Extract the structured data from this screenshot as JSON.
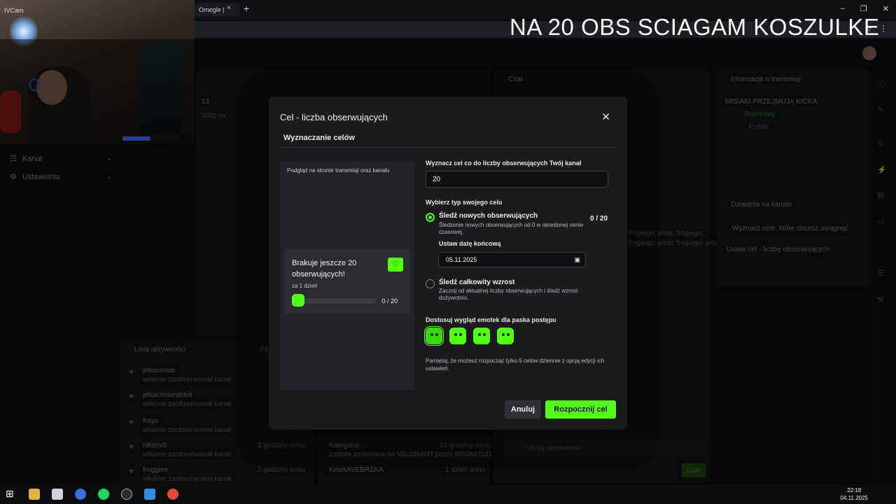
{
  "browser": {
    "tab_title": "Omegle |",
    "tab_close": "×",
    "new_tab": "+",
    "win_min": "–",
    "win_max": "❐",
    "win_close": "✕"
  },
  "overlay_title": "NA 20 OBS SCIAGAM KOSZULKE",
  "webcam_label": "IVCam",
  "sidebar": {
    "items": [
      {
        "label": "Kanal",
        "icon": "list-icon"
      },
      {
        "label": "Ustawienia",
        "icon": "gear-icon"
      }
    ]
  },
  "background": {
    "viewers_count": "13",
    "viewers_label": "Widzów",
    "chat_title": "Czat",
    "info_title": "Informacje o transmisji",
    "stream_name": "MISIAKI PRZEJMUJĄ KICKA",
    "category": "Rozmowy",
    "language": "Polish",
    "actions_title": "Działania na kanale",
    "actions_sub1": "Wyznacz cele, które chcesz osiągnąć",
    "actions_sub2": "Ustaw cel - liczbę obserwujących",
    "activity_title": "Lista aktywności",
    "activity_filter": "Fil",
    "activity": [
      {
        "name": "jebacmisie",
        "desc": "właśnie zaobserwował kanał"
      },
      {
        "name": "jebacmisiedebili",
        "desc": "właśnie zaobserwował kanał"
      },
      {
        "name": "Ksyo",
        "desc": "właśnie zaobserwował kanał"
      },
      {
        "name": "nikosv0",
        "desc": "właśnie zaobserwował kanał",
        "time": "2 godziny temu"
      },
      {
        "name": "froggiee",
        "desc": "właśnie zaobserwował kanał",
        "time": "2 godziny temu"
      }
    ],
    "events": [
      {
        "name": "Kategoria",
        "desc": "została zmieniona na VALORANT przez MISIAKI141",
        "time": "23 godziny temu"
      },
      {
        "name": "KinekAVEBRZKA",
        "desc": "",
        "time": "1 dzień temu"
      }
    ],
    "chat_input_placeholder": "Wyślij wiadomość",
    "chat_send": "Czat",
    "chat_lines": [
      "frogiego: jebac frogiego:",
      "frogiego: jebac frogiego: jebac"
    ]
  },
  "modal": {
    "title": "Cel - liczba obserwujących",
    "close": "✕",
    "subtitle": "Wyznaczanie celów",
    "preview_label": "Podgląd na stronie transmisji oraz kanału",
    "preview_card": {
      "title": "Brakuje jeszcze 20 obserwujących!",
      "sub": "za 1 dzień",
      "count": "0 / 20",
      "progress": 0
    },
    "goal_label": "Wyznacz cel co do liczby obserwujących Twój kanał",
    "goal_value": "20",
    "type_label": "Wybierz typ swojego celu",
    "option1": {
      "title": "Śledź nowych obserwujących",
      "desc": "Śledzenie nowych obserwujących od 0 w określonej ramie czasowej.",
      "count": "0 / 20",
      "selected": true
    },
    "date_label": "Ustaw datę końcową",
    "date_value": "05.11.2025",
    "option2": {
      "title": "Śledź całkowity wzrost",
      "desc": "Zacznij od aktualnej liczby obserwujących i śledź wzrost dożywotnio.",
      "selected": false
    },
    "emote_label": "Dostosuj wygląd emotek dla paska postępu",
    "note": "Pamiętaj, że możesz rozpocząć tylko 5 celów dziennie z opcją edycji ich ustawień.",
    "cancel": "Anuluj",
    "start": "Rozpocznij cel"
  },
  "taskbar": {
    "time": "22:18",
    "date": "04.11.2025"
  },
  "colors": {
    "accent": "#53fc18",
    "modal_bg": "#1a1b1d"
  }
}
